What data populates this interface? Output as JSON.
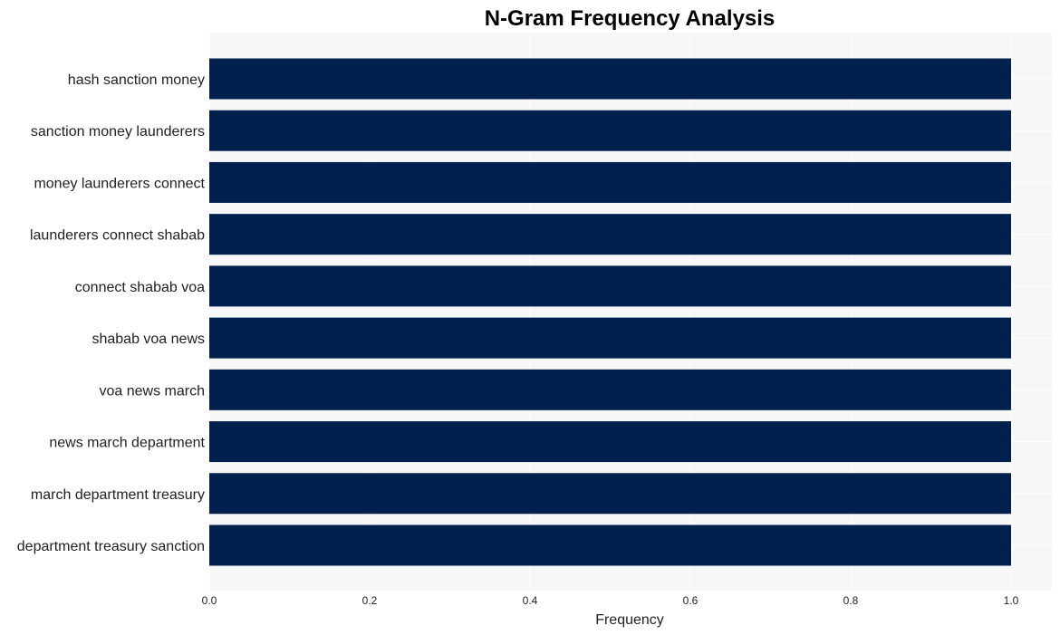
{
  "chart_data": {
    "type": "bar",
    "orientation": "horizontal",
    "title": "N-Gram Frequency Analysis",
    "xlabel": "Frequency",
    "ylabel": "",
    "categories": [
      "hash sanction money",
      "sanction money launderers",
      "money launderers connect",
      "launderers connect shabab",
      "connect shabab voa",
      "shabab voa news",
      "voa news march",
      "news march department",
      "march department treasury",
      "department treasury sanction"
    ],
    "values": [
      1,
      1,
      1,
      1,
      1,
      1,
      1,
      1,
      1,
      1
    ],
    "xlim": [
      0,
      1.05
    ],
    "xticks": [
      0.0,
      0.2,
      0.4,
      0.6,
      0.8,
      1.0
    ],
    "xtick_labels": [
      "0.0",
      "0.2",
      "0.4",
      "0.6",
      "0.8",
      "1.0"
    ],
    "grid": true,
    "legend": "none",
    "colors": {
      "bar": "#00204e",
      "plot_background": "#f7f7f7",
      "grid": "#ffffff"
    }
  }
}
